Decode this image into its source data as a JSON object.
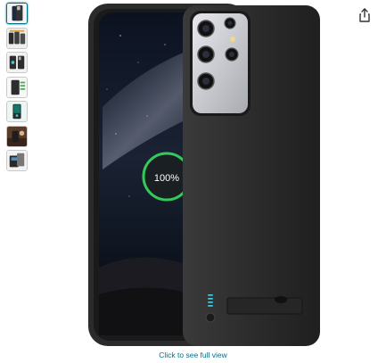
{
  "product": {
    "thumbnails": [
      {
        "icon": "case-front-back-thumbnail",
        "selected": true
      },
      {
        "icon": "case-lineup-thumbnail",
        "selected": false
      },
      {
        "icon": "case-features-thumbnail",
        "selected": false
      },
      {
        "icon": "case-specs-thumbnail",
        "selected": false
      },
      {
        "icon": "case-charging-thumbnail",
        "selected": false
      },
      {
        "icon": "case-lifestyle-thumbnail",
        "selected": false
      },
      {
        "icon": "case-package-thumbnail",
        "selected": false
      }
    ],
    "share_icon": "share-icon",
    "image": {
      "charge_badge": "100%"
    },
    "caption": "Click to see full view"
  },
  "colors": {
    "case": "#2b2b2b",
    "badge_ring": "#35c95a",
    "led": "#3cc8e0",
    "link": "#007185"
  }
}
